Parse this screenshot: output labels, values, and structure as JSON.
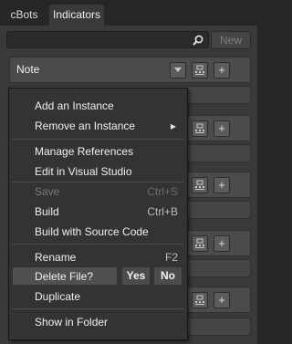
{
  "tabs": [
    {
      "label": "cBots",
      "active": false
    },
    {
      "label": "Indicators",
      "active": true
    }
  ],
  "search": {
    "placeholder": ""
  },
  "new_button": {
    "label": "New"
  },
  "list": {
    "first_item": {
      "name": "Note"
    }
  },
  "context_menu": {
    "items": {
      "add_instance": {
        "label": "Add an Instance"
      },
      "remove_instance": {
        "label": "Remove an Instance",
        "submenu": true
      },
      "manage_references": {
        "label": "Manage References"
      },
      "edit_vs": {
        "label": "Edit in Visual Studio"
      },
      "save": {
        "label": "Save",
        "shortcut": "Ctrl+S",
        "enabled": false
      },
      "build": {
        "label": "Build",
        "shortcut": "Ctrl+B"
      },
      "build_source": {
        "label": "Build with Source Code"
      },
      "rename": {
        "label": "Rename",
        "shortcut": "F2"
      },
      "delete": {
        "label": "Delete File?",
        "yes": "Yes",
        "no": "No"
      },
      "duplicate": {
        "label": "Duplicate"
      },
      "show_folder": {
        "label": "Show in Folder"
      }
    }
  },
  "colors": {
    "background": "#262626",
    "panel": "#3a3a3a",
    "row": "#4b4b4b",
    "menu": "#333333"
  }
}
